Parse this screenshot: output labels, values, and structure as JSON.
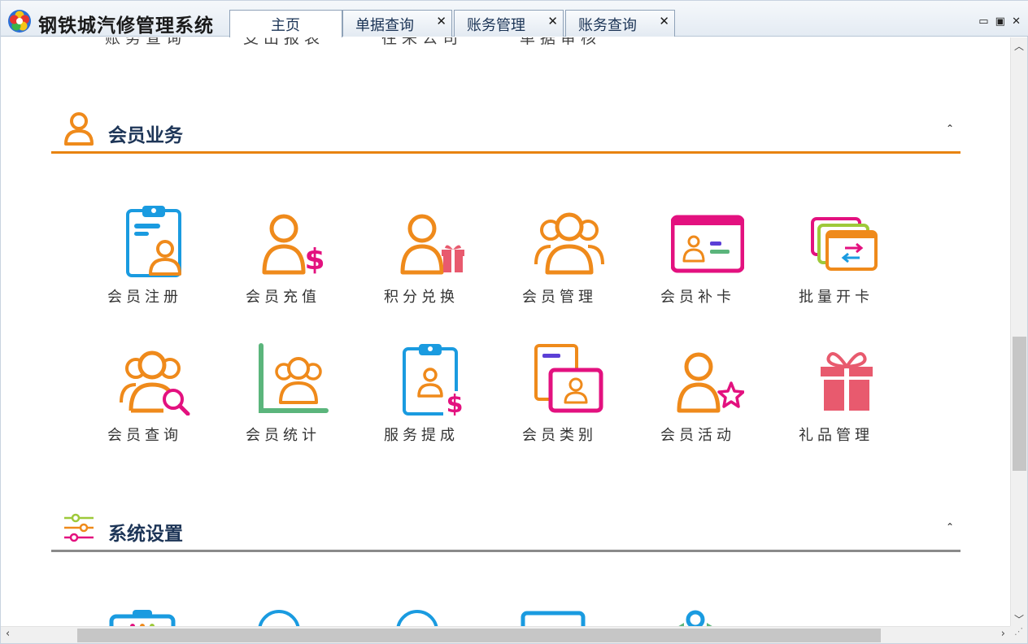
{
  "app": {
    "title": "钢铁城汽修管理系统",
    "logo_icon": "flower-logo-icon"
  },
  "tabs": [
    {
      "label": "主页",
      "active": true,
      "closable": false
    },
    {
      "label": "单据查询",
      "active": false,
      "closable": true
    },
    {
      "label": "账务管理",
      "active": false,
      "closable": true
    },
    {
      "label": "账务查询",
      "active": false,
      "closable": true
    }
  ],
  "tab_close_glyph": "✕",
  "window_controls": {
    "minimize": "▭",
    "restore": "▣",
    "close": "✕"
  },
  "partial_row": [
    "账务查询",
    "支出报表",
    "往来公司",
    "单据审核"
  ],
  "sections": {
    "member": {
      "title": "会员业务",
      "icon": "person-outline-icon",
      "accent": "#e8830f",
      "collapse_glyph": "⌃",
      "items": [
        {
          "label": "会员注册",
          "icon": "clipboard-member-icon"
        },
        {
          "label": "会员充值",
          "icon": "member-dollar-icon"
        },
        {
          "label": "积分兑换",
          "icon": "member-gift-icon"
        },
        {
          "label": "会员管理",
          "icon": "member-group-icon"
        },
        {
          "label": "会员补卡",
          "icon": "member-card-icon"
        },
        {
          "label": "批量开卡",
          "icon": "card-stack-icon"
        },
        {
          "label": "会员查询",
          "icon": "member-search-icon"
        },
        {
          "label": "会员统计",
          "icon": "member-chart-icon"
        },
        {
          "label": "服务提成",
          "icon": "clipboard-dollar-icon"
        },
        {
          "label": "会员类别",
          "icon": "member-category-icon"
        },
        {
          "label": "会员活动",
          "icon": "member-star-icon"
        },
        {
          "label": "礼品管理",
          "icon": "gift-box-icon"
        }
      ]
    },
    "system": {
      "title": "系统设置",
      "icon": "sliders-icon",
      "accent": "#8a8a8a",
      "collapse_glyph": "⌃"
    }
  },
  "colors": {
    "orange": "#ef8a1b",
    "blue": "#1a9be0",
    "magenta": "#e3117f",
    "green": "#5bb57c",
    "lime": "#9ec93a",
    "red": "#e85a6e",
    "purple": "#5b3fd6"
  }
}
